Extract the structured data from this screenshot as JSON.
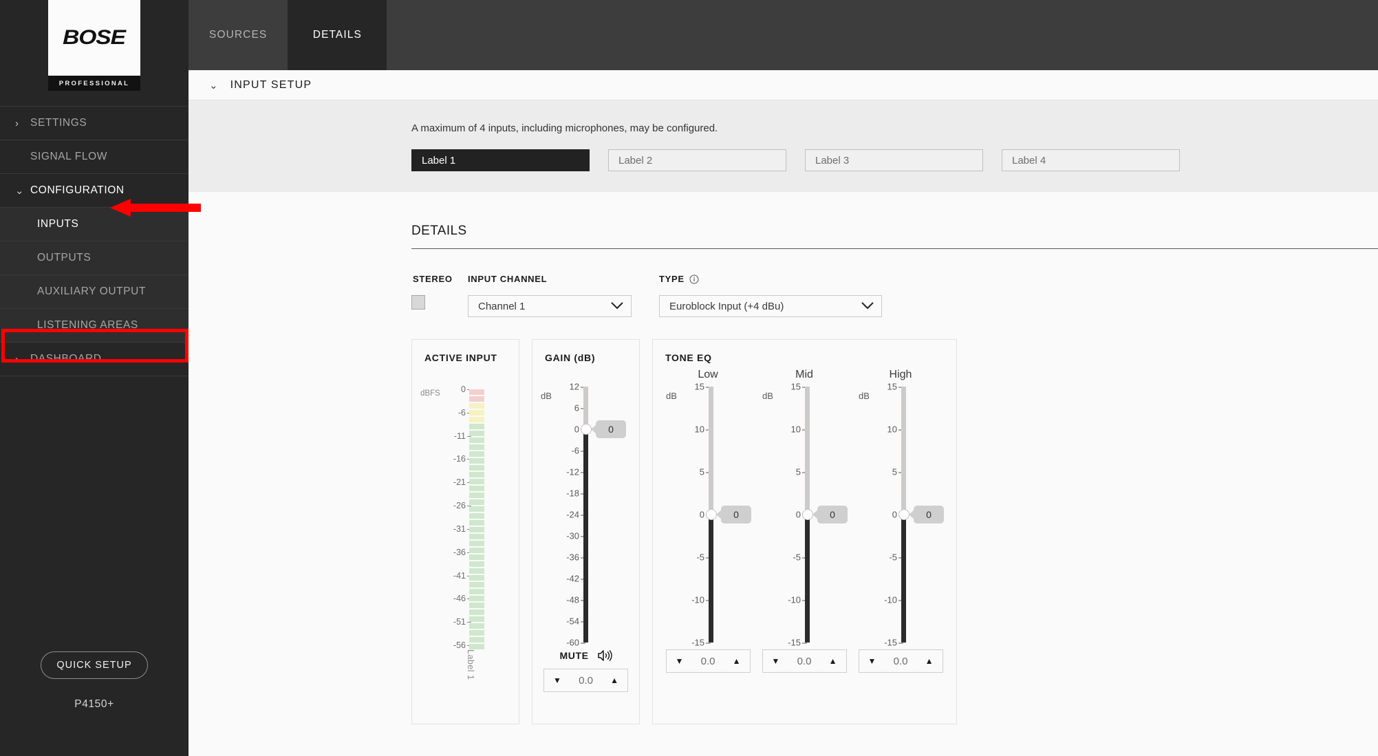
{
  "brand": {
    "logo_text": "BOSE",
    "logo_sub": "PROFESSIONAL"
  },
  "sidebar": {
    "items": [
      {
        "label": "SETTINGS",
        "chevron": "›",
        "sub": false,
        "active": false
      },
      {
        "label": "SIGNAL FLOW",
        "chevron": "",
        "sub": false,
        "active": false
      },
      {
        "label": "CONFIGURATION",
        "chevron": "⌄",
        "sub": false,
        "active": true
      },
      {
        "label": "INPUTS",
        "chevron": "",
        "sub": true,
        "active": true
      },
      {
        "label": "OUTPUTS",
        "chevron": "",
        "sub": true,
        "active": false
      },
      {
        "label": "AUXILIARY OUTPUT",
        "chevron": "",
        "sub": true,
        "active": false
      },
      {
        "label": "LISTENING AREAS",
        "chevron": "",
        "sub": true,
        "active": false
      },
      {
        "label": "DASHBOARD",
        "chevron": "›",
        "sub": false,
        "active": false
      }
    ],
    "quick_setup_label": "QUICK SETUP",
    "device_name": "P4150+"
  },
  "topbar": {
    "tabs": [
      {
        "label": "SOURCES",
        "active": false
      },
      {
        "label": "DETAILS",
        "active": true
      }
    ],
    "help_icon": "help-circle-icon"
  },
  "input_setup": {
    "section_title": "INPUT SETUP",
    "collapse_chevron": "⌄",
    "note": "A maximum of 4 inputs, including microphones, may be configured.",
    "labels": [
      {
        "text": "Label 1",
        "active": true
      },
      {
        "text": "Label 2",
        "active": false
      },
      {
        "text": "Label 3",
        "active": false
      },
      {
        "text": "Label 4",
        "active": false
      }
    ]
  },
  "details": {
    "title": "DETAILS",
    "stereo": {
      "label": "STEREO",
      "checked": false
    },
    "input_channel": {
      "label": "INPUT CHANNEL",
      "value": "Channel 1"
    },
    "type": {
      "label": "TYPE",
      "value": "Euroblock Input (+4 dBu)",
      "info_icon": "info-icon"
    }
  },
  "active_input": {
    "panel_title": "ACTIVE INPUT",
    "unit": "dBFS",
    "ticks": [
      "0",
      "-6",
      "-11",
      "-16",
      "-21",
      "-26",
      "-31",
      "-36",
      "-41",
      "-46",
      "-51",
      "-56"
    ],
    "channel_label": "Label 1",
    "colors": {
      "peak": "#f4cfd0",
      "warn": "#f6f2c2",
      "ok": "#cfe8cd"
    }
  },
  "gain": {
    "panel_title": "GAIN (dB)",
    "unit": "dB",
    "ticks": [
      "12",
      "6",
      "0",
      "-6",
      "-12",
      "-18",
      "-24",
      "-30",
      "-36",
      "-42",
      "-48",
      "-54",
      "-60"
    ],
    "min": -60,
    "max": 12,
    "value": 0,
    "bubble_value": "0",
    "mute_label": "MUTE",
    "mute_icon": "speaker-icon",
    "stepper_value": "0.0",
    "stepper_down_icon": "triangle-down-icon",
    "stepper_up_icon": "triangle-up-icon"
  },
  "tone_eq": {
    "panel_title": "TONE EQ",
    "bands": [
      {
        "name": "Low",
        "unit": "dB",
        "value": 0,
        "bubble_value": "0",
        "stepper_value": "0.0"
      },
      {
        "name": "Mid",
        "unit": "dB",
        "value": 0,
        "bubble_value": "0",
        "stepper_value": "0.0"
      },
      {
        "name": "High",
        "unit": "dB",
        "value": 0,
        "bubble_value": "0",
        "stepper_value": "0.0"
      }
    ],
    "ticks": [
      "15",
      "10",
      "5",
      "0",
      "-5",
      "-10",
      "-15"
    ],
    "min": -15,
    "max": 15
  },
  "annotations": {
    "arrow_color": "#ff0000",
    "rect_color": "#ff0000",
    "arrow_target": "CONFIGURATION",
    "rect_target": "LISTENING AREAS"
  }
}
